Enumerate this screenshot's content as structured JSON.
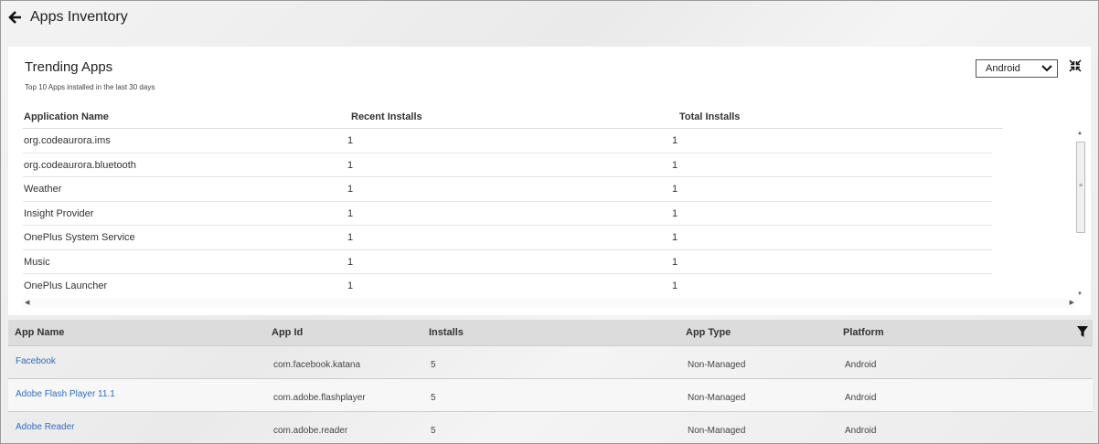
{
  "header": {
    "title": "Apps Inventory"
  },
  "trending": {
    "title": "Trending Apps",
    "subtitle": "Top 10 Apps installed in the last 30 days",
    "platform_selected": "Android",
    "columns": [
      "Application Name",
      "Recent Installs",
      "Total Installs"
    ],
    "rows": [
      {
        "name": "org.codeaurora.ims",
        "recent": "1",
        "total": "1"
      },
      {
        "name": "org.codeaurora.bluetooth",
        "recent": "1",
        "total": "1"
      },
      {
        "name": "Weather",
        "recent": "1",
        "total": "1"
      },
      {
        "name": "Insight Provider",
        "recent": "1",
        "total": "1"
      },
      {
        "name": "OnePlus System Service",
        "recent": "1",
        "total": "1"
      },
      {
        "name": "Music",
        "recent": "1",
        "total": "1"
      },
      {
        "name": "OnePlus Launcher",
        "recent": "1",
        "total": "1"
      }
    ]
  },
  "apps": {
    "columns": [
      "App Name",
      "App Id",
      "Installs",
      "App Type",
      "Platform"
    ],
    "rows": [
      {
        "name": "Facebook",
        "id": "com.facebook.katana",
        "installs": "5",
        "type": "Non-Managed",
        "platform": "Android"
      },
      {
        "name": "Adobe Flash Player 11.1",
        "id": "com.adobe.flashplayer",
        "installs": "5",
        "type": "Non-Managed",
        "platform": "Android"
      },
      {
        "name": "Adobe Reader",
        "id": "com.adobe.reader",
        "installs": "5",
        "type": "Non-Managed",
        "platform": "Android"
      }
    ]
  },
  "icons": {
    "back": "arrow-left-icon",
    "select": "chevron-down-icon",
    "collapse": "collapse-arrows-icon",
    "filter": "funnel-icon"
  },
  "colors": {
    "link": "#2f6dc2",
    "header_bg": "#dcdcdc"
  }
}
